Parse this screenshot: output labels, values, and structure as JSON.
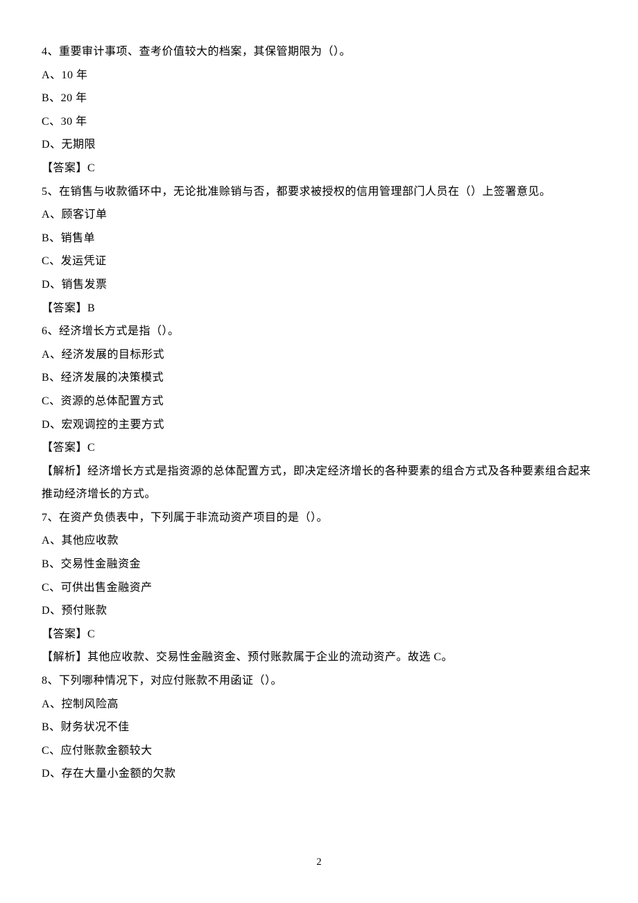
{
  "questions": [
    {
      "stem": "4、重要审计事项、查考价值较大的档案，其保管期限为（）。",
      "options": [
        "A、10 年",
        "B、20 年",
        "C、30 年",
        "D、无期限"
      ],
      "answer": "【答案】C"
    },
    {
      "stem": "5、在销售与收款循环中，无论批准赊销与否，都要求被授权的信用管理部门人员在（）上签署意见。",
      "options": [
        "A、顾客订单",
        "B、销售单",
        "C、发运凭证",
        "D、销售发票"
      ],
      "answer": "【答案】B"
    },
    {
      "stem": "6、经济增长方式是指（）。",
      "options": [
        "A、经济发展的目标形式",
        "B、经济发展的决策模式",
        "C、资源的总体配置方式",
        "D、宏观调控的主要方式"
      ],
      "answer": "【答案】C",
      "explain": "【解析】经济增长方式是指资源的总体配置方式，即决定经济增长的各种要素的组合方式及各种要素组合起来推动经济增长的方式。"
    },
    {
      "stem": "7、在资产负债表中，下列属于非流动资产项目的是（）。",
      "options": [
        "A、其他应收款",
        "B、交易性金融资金",
        "C、可供出售金融资产",
        "D、预付账款"
      ],
      "answer": "【答案】C",
      "explain": "【解析】其他应收款、交易性金融资金、预付账款属于企业的流动资产。故选 C。"
    },
    {
      "stem": "8、下列哪种情况下，对应付账款不用函证（）。",
      "options": [
        "A、控制风险高",
        "B、财务状况不佳",
        "C、应付账款金额较大",
        "D、存在大量小金额的欠款"
      ]
    }
  ],
  "pageNumber": "2"
}
